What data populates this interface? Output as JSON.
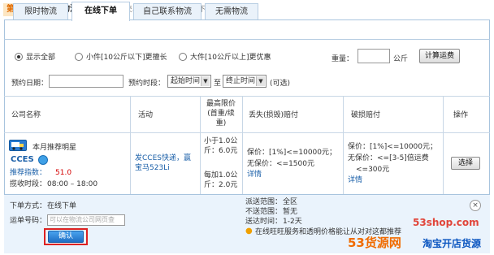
{
  "header": {
    "step": "第三步",
    "title": "选择物流服务",
    "hint": "（您交易发生的地区支持以下物流方式）"
  },
  "tabs": [
    {
      "label": "限时物流"
    },
    {
      "label": "在线下单",
      "active": true
    },
    {
      "label": "自己联系物流"
    },
    {
      "label": "无需物流"
    }
  ],
  "filters": {
    "options": [
      {
        "label": "显示全部",
        "selected": true
      },
      {
        "label": "小件[10公斤以下]更擅长",
        "selected": false
      },
      {
        "label": "大件[10公斤以上]更优惠",
        "selected": false
      }
    ],
    "weight_label": "重量：",
    "weight_value": "",
    "weight_unit": "公斤",
    "calc_button": "计算运费"
  },
  "date_row": {
    "date_label": "预约日期：",
    "date_value": "",
    "time_label": "预约时段：",
    "start_select": "起始时间",
    "to": "至",
    "end_select": "终止时间",
    "optional": "(可选)"
  },
  "table": {
    "headers": {
      "company": "公司名称",
      "activity": "活动",
      "min_price": "最高限价(首重/续重)",
      "loss": "丢失(损毁)赔付",
      "damage": "破损赔付",
      "action": "操作"
    },
    "row": {
      "badge": "本月推荐明星",
      "company_name": "CCES",
      "rating_label": "推荐指数：",
      "rating_value": "51.0",
      "pickup_label": "揽收时段：",
      "pickup_value": "08:00 – 18:00",
      "activity": "发CCES快递，赢宝马523Li",
      "price_first": "小于1.0公斤：6.0元",
      "price_additional": "每加1.0公斤：2.0元",
      "loss_line1": "保价：[1%]<=10000元；",
      "loss_line2": "无保价：<=1500元",
      "loss_detail": "详情",
      "damage_line1": "保价：[1%]<=10000元；",
      "damage_line2": "无保价：<=[3-5]倍运费",
      "damage_line3": "<=300元",
      "damage_detail": "详情",
      "select_button": "选择"
    }
  },
  "expanded": {
    "order_method_label": "下单方式：",
    "order_method_value": "在线下单",
    "tracking_label": "运单号码：",
    "tracking_placeholder": "可以在物流公司网页查",
    "confirm_button": "确认",
    "area_label": "派送范围：",
    "area_value": "全区",
    "excluded_label": "不送范围：",
    "excluded_value": "暂无",
    "time_label": "送达时间：",
    "time_value": "1-2天",
    "notice": "在线旺旺服务和透明价格能让从对对这都推荐"
  },
  "watermark": {
    "site": "53shop.com",
    "brand": "53货源网",
    "tagline": "淘宝开店货源"
  }
}
